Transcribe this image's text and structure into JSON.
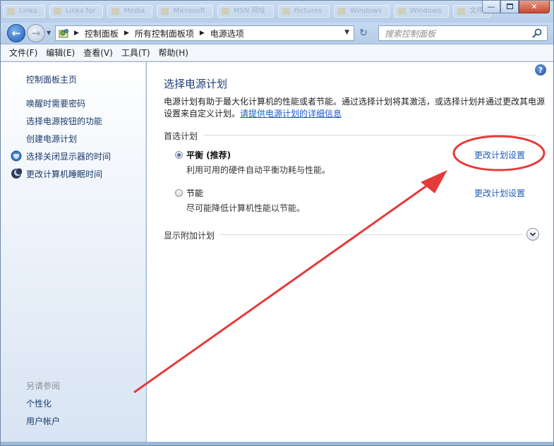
{
  "titlebar": {
    "background_tabs": [
      "Links",
      "Links for",
      "Media",
      "Microsoft",
      "MSN 网址",
      "Pictures",
      "Windows",
      "Windows",
      "文件"
    ],
    "minimize_icon": "minimize-icon",
    "maximize_icon": "maximize-icon",
    "close_icon": "close-icon"
  },
  "navbar": {
    "breadcrumbs": [
      "控制面板",
      "所有控制面板项",
      "电源选项"
    ],
    "search_placeholder": "搜索控制面板"
  },
  "menubar": {
    "items": [
      "文件(F)",
      "编辑(E)",
      "查看(V)",
      "工具(T)",
      "帮助(H)"
    ]
  },
  "sidebar": {
    "home": "控制面板主页",
    "links": [
      "唤醒时需要密码",
      "选择电源按钮的功能",
      "创建电源计划",
      "选择关闭显示器的时间",
      "更改计算机睡眠时间"
    ],
    "see_also_heading": "另请参阅",
    "see_also_links": [
      "个性化",
      "用户帐户"
    ]
  },
  "main": {
    "title": "选择电源计划",
    "description": "电源计划有助于最大化计算机的性能或者节能。通过选择计划将其激活，或选择计划并通过更改其电源设置来自定义计划。",
    "description_link": "请提供电源计划的详细信息",
    "preferred_plans_label": "首选计划",
    "plans": [
      {
        "name": "平衡 (推荐)",
        "description": "利用可用的硬件自动平衡功耗与性能。",
        "selected": true,
        "settings_link": "更改计划设置"
      },
      {
        "name": "节能",
        "description": "尽可能降低计算机性能以节能。",
        "selected": false,
        "settings_link": "更改计划设置"
      }
    ],
    "additional_plans_label": "显示附加计划"
  },
  "annotation": {
    "color": "#e53a3a"
  }
}
